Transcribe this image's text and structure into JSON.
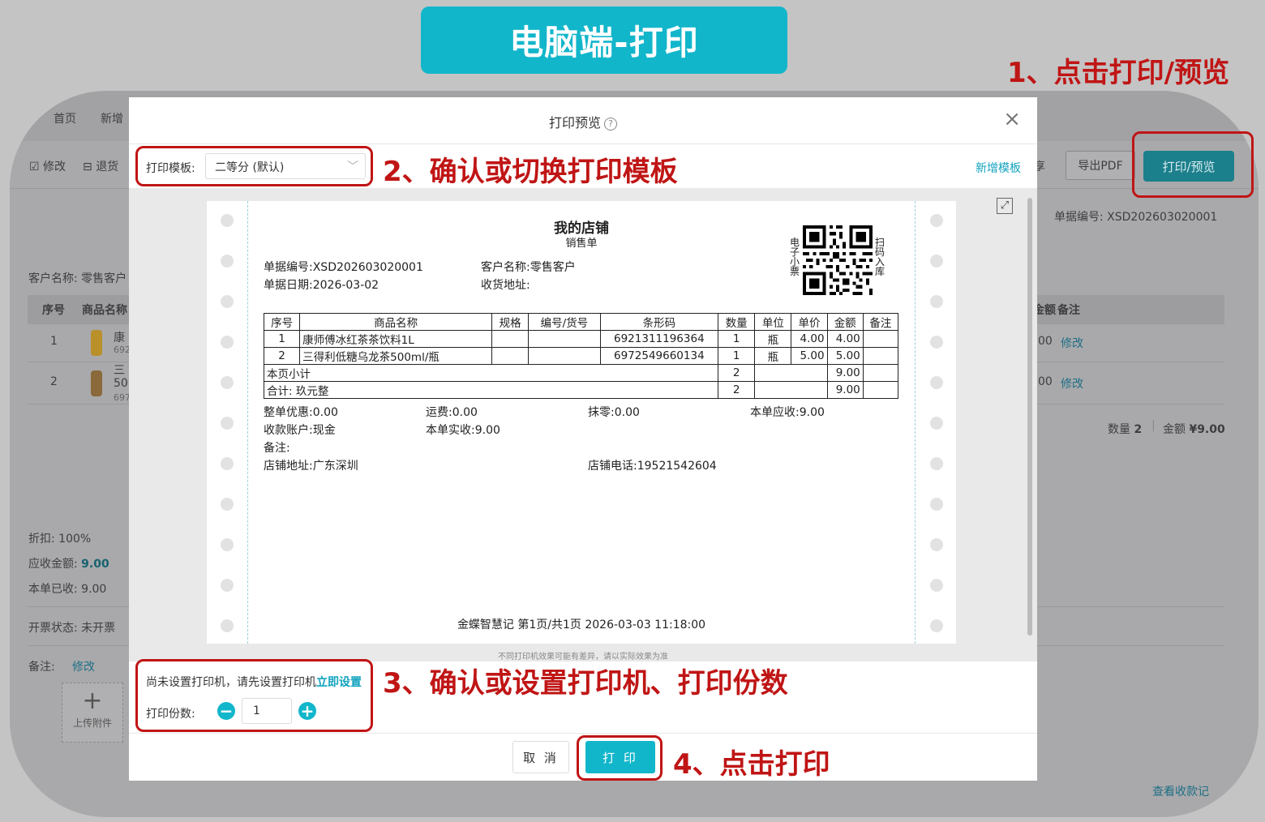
{
  "banner": {
    "title": "电脑端-打印"
  },
  "steps": {
    "step1": "1、点击打印/预览",
    "step2": "2、确认或切换打印模板",
    "step3": "3、确认或设置打印机、打印份数",
    "step4": "4、点击打印"
  },
  "background": {
    "tabs": [
      "首页",
      "新增"
    ],
    "toolbar": {
      "edit": "修改",
      "return": "退货",
      "share_tail": "享",
      "export_pdf": "导出PDF",
      "print_preview": "打印/预览"
    },
    "order_no": "单据编号: XSD202603020001",
    "customer": "客户名称:  零售客户",
    "columns": {
      "index": "序号",
      "product": "商品名称",
      "amount_tail": "金额",
      "remark": "备注"
    },
    "rows": [
      {
        "index": "1",
        "name_head": "康",
        "code_head": "692",
        "amount_tail": "00",
        "action": "修改"
      },
      {
        "index": "2",
        "name_head": "三",
        "name_line2": "50",
        "code_head": "697",
        "amount_tail": "00",
        "action": "修改"
      }
    ],
    "summary": {
      "qty_label": "数量",
      "qty": "2",
      "amount_label": "金额",
      "amount": "¥9.00"
    },
    "discount": "折扣:  100%",
    "receivable_label": "应收金额:",
    "receivable_value": "9.00",
    "received": "本单已收:  9.00",
    "invoice": "开票状态:   未开票",
    "remark_label": "备注:",
    "remark_action": "修改",
    "upload": "上传附件",
    "view_payments": "查看收款记"
  },
  "modal": {
    "title": "打印预览",
    "help_icon": "?",
    "close_icon": "×",
    "template_label": "打印模板:",
    "template_value": "二等分 (默认)",
    "new_template": "新增模板",
    "preview_note": "不同打印机效果可能有差异，请以实际效果为准",
    "printer_msg": "尚未设置打印机，请先设置打印机",
    "printer_link": "立即设置",
    "copies_label": "打印份数:",
    "copies_value": "1",
    "cancel": "取 消",
    "print": "打 印"
  },
  "receipt": {
    "shop": "我的店铺",
    "doc_type": "销售单",
    "qr_left": [
      "电",
      "子",
      "小",
      "票"
    ],
    "qr_right": [
      "扫",
      "码",
      "入",
      "库"
    ],
    "order_no": "单据编号:XSD202603020001",
    "customer": "客户名称:零售客户",
    "date": "单据日期:2026-03-02",
    "address": "收货地址:",
    "headers": [
      "序号",
      "商品名称",
      "规格",
      "编号/货号",
      "条形码",
      "数量",
      "单位",
      "单价",
      "金额",
      "备注"
    ],
    "items": [
      {
        "no": "1",
        "name": "康师傅冰红茶茶饮料1L",
        "spec": "",
        "sku": "",
        "barcode": "6921311196364",
        "qty": "1",
        "unit": "瓶",
        "price": "4.00",
        "amount": "4.00",
        "remark": ""
      },
      {
        "no": "2",
        "name": "三得利低糖乌龙茶500ml/瓶",
        "spec": "",
        "sku": "",
        "barcode": "6972549660134",
        "qty": "1",
        "unit": "瓶",
        "price": "5.00",
        "amount": "5.00",
        "remark": ""
      }
    ],
    "subtotal": {
      "label": "本页小计",
      "qty": "2",
      "amount": "9.00"
    },
    "total": {
      "label": "合计: 玖元整",
      "qty": "2",
      "amount": "9.00"
    },
    "discount": "整单优惠:0.00",
    "freight": "运费:0.00",
    "rounding": "抹零:0.00",
    "payable": "本单应收:9.00",
    "account": "收款账户:现金",
    "paid": "本单实收:9.00",
    "remark": "备注:",
    "shop_address": "店铺地址:广东深圳",
    "shop_phone": "店铺电话:19521542604",
    "footer": "金蝶智慧记   第1页/共1页   2026-03-03 11:18:00"
  }
}
